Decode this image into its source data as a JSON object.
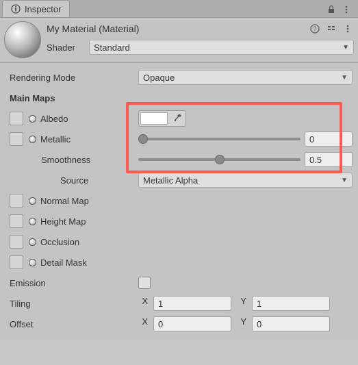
{
  "tab": {
    "title": "Inspector"
  },
  "header": {
    "title": "My Material (Material)",
    "shader_label": "Shader",
    "shader_value": "Standard"
  },
  "rendering_mode": {
    "label": "Rendering Mode",
    "value": "Opaque"
  },
  "main_maps": {
    "label": "Main Maps"
  },
  "albedo": {
    "label": "Albedo",
    "color": "#ffffff"
  },
  "metallic": {
    "label": "Metallic",
    "value": "0",
    "slider_pct": 0
  },
  "smoothness": {
    "label": "Smoothness",
    "value": "0.5",
    "slider_pct": 50
  },
  "source": {
    "label": "Source",
    "value": "Metallic Alpha"
  },
  "normal_map": {
    "label": "Normal Map"
  },
  "height_map": {
    "label": "Height Map"
  },
  "occlusion": {
    "label": "Occlusion"
  },
  "detail_mask": {
    "label": "Detail Mask"
  },
  "emission": {
    "label": "Emission",
    "checked": false
  },
  "tiling": {
    "label": "Tiling",
    "x": "1",
    "y": "1"
  },
  "offset": {
    "label": "Offset",
    "x": "0",
    "y": "0"
  },
  "axis": {
    "x": "X",
    "y": "Y"
  }
}
